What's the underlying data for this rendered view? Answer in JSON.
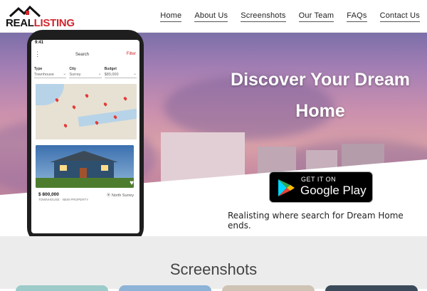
{
  "brand": {
    "name_part1": "REAL",
    "name_part2": "LISTING",
    "accent": "#d1262e"
  },
  "nav": [
    {
      "label": "Home"
    },
    {
      "label": "About Us"
    },
    {
      "label": "Screenshots"
    },
    {
      "label": "Our Team"
    },
    {
      "label": "FAQs"
    },
    {
      "label": "Contact Us"
    }
  ],
  "hero": {
    "title_line1": "Discover Your Dream",
    "title_line2": "Home",
    "store_badge": {
      "small": "GET IT ON",
      "big": "Google Play"
    },
    "tagline": "Realisting where search for Dream Home ends."
  },
  "phone": {
    "status_time": "9:41",
    "app_title": "Search",
    "filter_label": "Filter",
    "menu_icon": "menu-dots-icon",
    "filters": [
      {
        "label": "Type",
        "value": "Townhouse"
      },
      {
        "label": "City",
        "value": "Surrey"
      },
      {
        "label": "Budget",
        "value": "$80,000"
      }
    ],
    "listing": {
      "price": "$ 800,000",
      "location": "North Surrey",
      "subtitle": "TOWNHOUSE · NEW PROPERTY",
      "favorite_icon": "heart-icon"
    }
  },
  "screenshots": {
    "heading": "Screenshots"
  }
}
